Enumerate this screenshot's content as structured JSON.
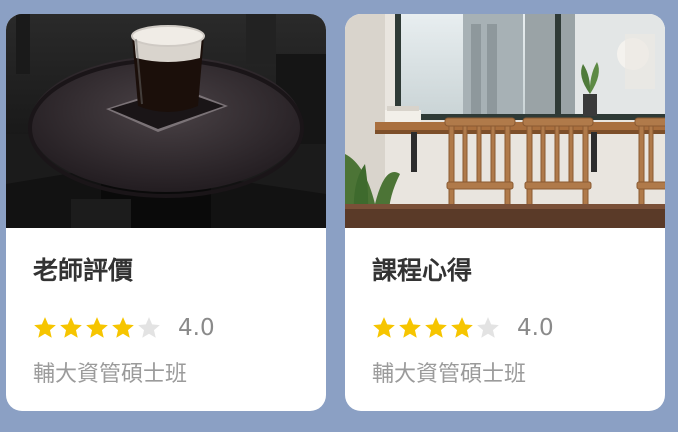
{
  "cards": [
    {
      "title": "老師評價",
      "rating": 4,
      "rating_max": 5,
      "score_text": "4.0",
      "subtitle": "輔大資管碩士班",
      "image": "coffee-glass-on-dark-round-table"
    },
    {
      "title": "課程心得",
      "rating": 4,
      "rating_max": 5,
      "score_text": "4.0",
      "subtitle": "輔大資管碩士班",
      "image": "cafe-window-bar-with-wooden-stools"
    }
  ],
  "colors": {
    "background": "#8ba0c4",
    "star_filled": "#f6c500",
    "star_empty": "#e3e3e3",
    "title": "#333333",
    "muted": "#9b9b9b"
  }
}
